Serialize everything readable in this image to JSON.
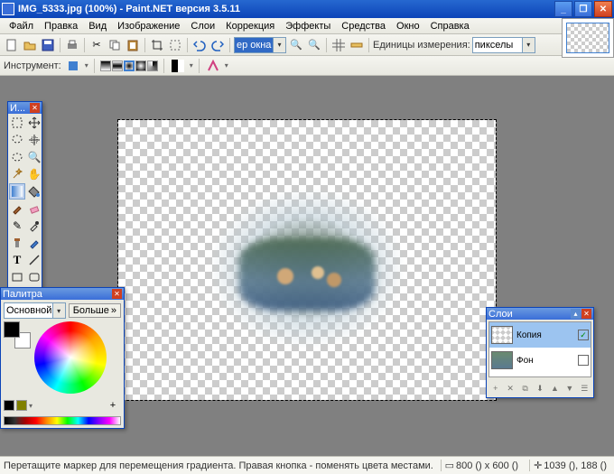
{
  "title": "IMG_5333.jpg (100%) - Paint.NET версия 3.5.11",
  "menu": [
    "Файл",
    "Правка",
    "Вид",
    "Изображение",
    "Слои",
    "Коррекция",
    "Эффекты",
    "Средства",
    "Окно",
    "Справка"
  ],
  "toolbar": {
    "zoom_combo": "ер окна",
    "units_label": "Единицы измерения:",
    "units_value": "пикселы"
  },
  "tooloptions": {
    "label": "Инструмент:"
  },
  "tools_panel": {
    "title": "И..."
  },
  "colors_panel": {
    "title": "Палитра",
    "mode": "Основной",
    "more": "Больше"
  },
  "layers_panel": {
    "title": "Слои",
    "layers": [
      {
        "name": "Копия",
        "visible": true,
        "active": true
      },
      {
        "name": "Фон",
        "visible": false,
        "active": false
      }
    ]
  },
  "status": {
    "msg": "Перетащите маркер для перемещения градиента. Правая кнопка - поменять цвета местами. Клавиша ВВОД - заверш",
    "dims": "800 () x 600 ()",
    "coords": "1039 (), 188 ()"
  }
}
